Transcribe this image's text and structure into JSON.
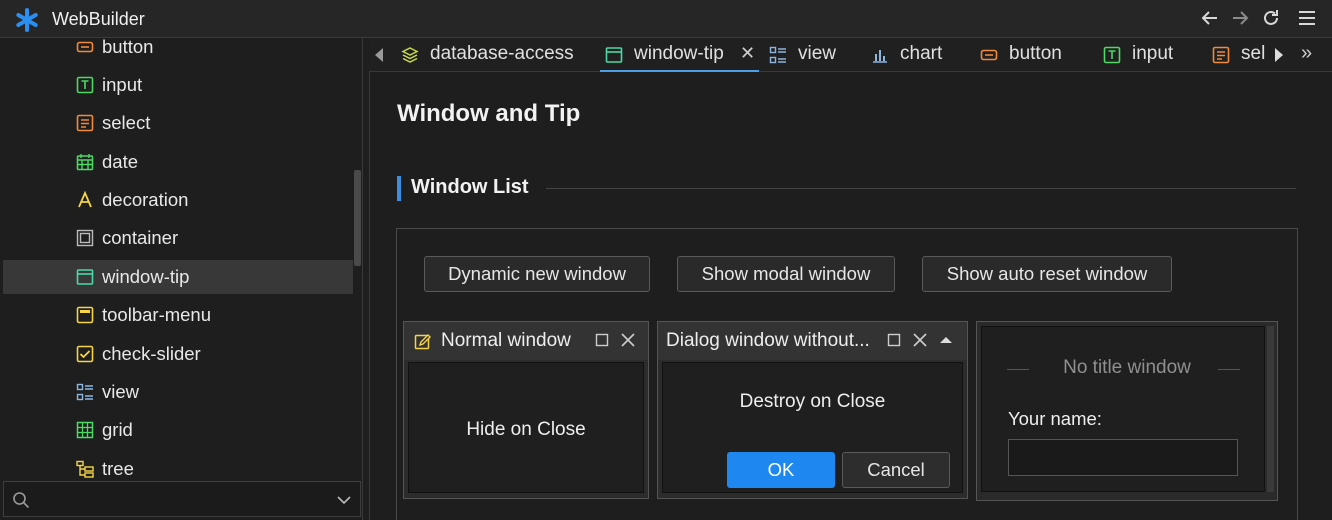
{
  "app": {
    "title": "WebBuilder"
  },
  "titlebar": {
    "back_icon": "arrow-left-icon",
    "forward_icon": "arrow-right-icon",
    "refresh_icon": "refresh-icon",
    "menu_icon": "hamburger-icon"
  },
  "sidebar": {
    "items": [
      {
        "label": "button",
        "icon": "button-icon",
        "color": "#f08a3c"
      },
      {
        "label": "input",
        "icon": "input-icon",
        "color": "#4cd964"
      },
      {
        "label": "select",
        "icon": "select-icon",
        "color": "#f08a3c"
      },
      {
        "label": "date",
        "icon": "calendar-icon",
        "color": "#4cd964"
      },
      {
        "label": "decoration",
        "icon": "font-icon",
        "color": "#f5d547"
      },
      {
        "label": "container",
        "icon": "container-icon",
        "color": "#bbbbbb"
      },
      {
        "label": "window-tip",
        "icon": "window-icon",
        "color": "#4cd9a8",
        "active": true
      },
      {
        "label": "toolbar-menu",
        "icon": "toolbar-icon",
        "color": "#f5d547"
      },
      {
        "label": "check-slider",
        "icon": "checkbox-icon",
        "color": "#f5d547"
      },
      {
        "label": "view",
        "icon": "view-icon",
        "color": "#8fb6e0"
      },
      {
        "label": "grid",
        "icon": "grid-icon",
        "color": "#4cd964"
      },
      {
        "label": "tree",
        "icon": "tree-icon",
        "color": "#f5d547"
      }
    ],
    "search_placeholder": ""
  },
  "tabs": [
    {
      "label": "database-access",
      "icon": "database-icon",
      "color": "#c8d84a"
    },
    {
      "label": "window-tip",
      "icon": "window-icon",
      "color": "#4cd9a8",
      "active": true,
      "closable": true
    },
    {
      "label": "view",
      "icon": "view-icon",
      "color": "#8fb6e0"
    },
    {
      "label": "chart",
      "icon": "bar-chart-icon",
      "color": "#8fb6e0"
    },
    {
      "label": "button",
      "icon": "button-icon",
      "color": "#f08a3c"
    },
    {
      "label": "input",
      "icon": "input-icon",
      "color": "#4cd964"
    },
    {
      "label": "sel",
      "icon": "select-icon",
      "color": "#f08a3c"
    }
  ],
  "page": {
    "title": "Window and Tip",
    "section_title": "Window List",
    "buttons": [
      "Dynamic new window",
      "Show modal window",
      "Show auto reset window"
    ],
    "normal_window": {
      "title": "Normal window",
      "body": "Hide on Close"
    },
    "dialog_window": {
      "title": "Dialog window without...",
      "body": "Destroy on Close",
      "ok": "OK",
      "cancel": "Cancel"
    },
    "no_title_window": {
      "legend": "No title window",
      "name_label": "Your name:",
      "name_value": ""
    }
  }
}
